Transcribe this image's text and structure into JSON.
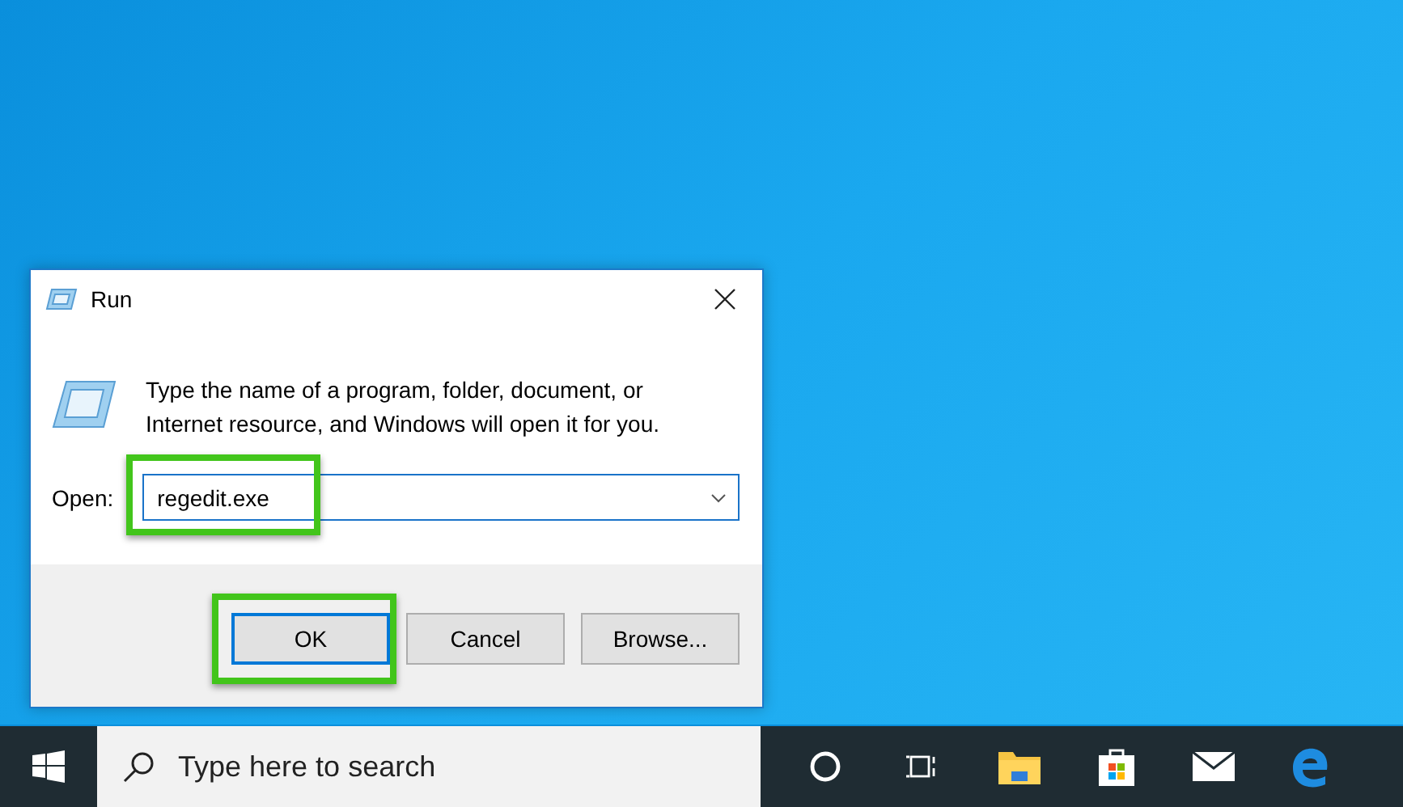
{
  "window": {
    "title": "Run"
  },
  "description": "Type the name of a program, folder, document, or Internet resource, and Windows will open it for you.",
  "open_field": {
    "label": "Open:",
    "value": "regedit.exe"
  },
  "buttons": [
    {
      "label": "OK",
      "selected": true
    },
    {
      "label": "Cancel",
      "selected": false
    },
    {
      "label": "Browse...",
      "selected": false
    }
  ],
  "taskbar": {
    "search": {
      "placeholder": "Type here to search"
    }
  }
}
